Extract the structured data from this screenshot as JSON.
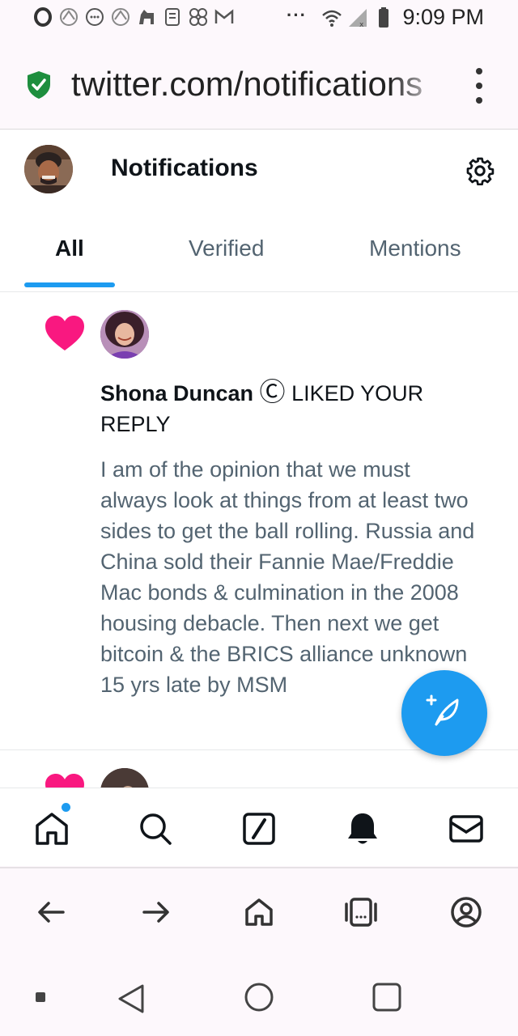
{
  "status_bar": {
    "time": "9:09 PM",
    "more": "···",
    "left_icons": [
      "opera-icon",
      "badge-icon",
      "chat-bubble-icon",
      "badge-icon",
      "horse-icon",
      "notebook-icon",
      "pinwheel-icon",
      "gmail-icon"
    ],
    "right_icons": [
      "wifi-icon",
      "signal-icon",
      "battery-icon"
    ]
  },
  "browser": {
    "url": "twitter.com/notifications",
    "secure_icon": "shield-check-icon",
    "menu_icon": "more-vertical-icon",
    "toolbar_icons": [
      "back-arrow-icon",
      "forward-arrow-icon",
      "home-icon",
      "tabs-icon",
      "account-icon"
    ]
  },
  "header": {
    "title": "Notifications",
    "settings_icon": "gear-icon"
  },
  "tabs": [
    {
      "label": "All",
      "active": true
    },
    {
      "label": "Verified",
      "active": false
    },
    {
      "label": "Mentions",
      "active": false
    }
  ],
  "notifications": [
    {
      "user": "Shona Duncan",
      "badge": "Ⓒ",
      "action": "LIKED YOUR REPLY",
      "text": "I am of the opinion that we must always look at things from at least two sides to get the ball rolling. Russia and China sold their Fannie Mae/Freddie Mac bonds & culmination in the 2008 housing debacle. Then next we get bitcoin & the BRICS alliance unknown 15 yrs late by MSM",
      "icon": "heart-icon"
    }
  ],
  "fab": {
    "icon": "compose-icon"
  },
  "bottom_nav": {
    "items": [
      "home-icon",
      "search-icon",
      "grok-icon",
      "bell-icon",
      "mail-icon"
    ],
    "home_has_dot": true
  },
  "system_nav": [
    "recents-dot-icon",
    "back-triangle-icon",
    "home-circle-icon",
    "overview-square-icon"
  ],
  "colors": {
    "accent": "#1d9bf0",
    "heart": "#f91880",
    "secondary_text": "#536471",
    "secure_green": "#1e8e3e"
  }
}
